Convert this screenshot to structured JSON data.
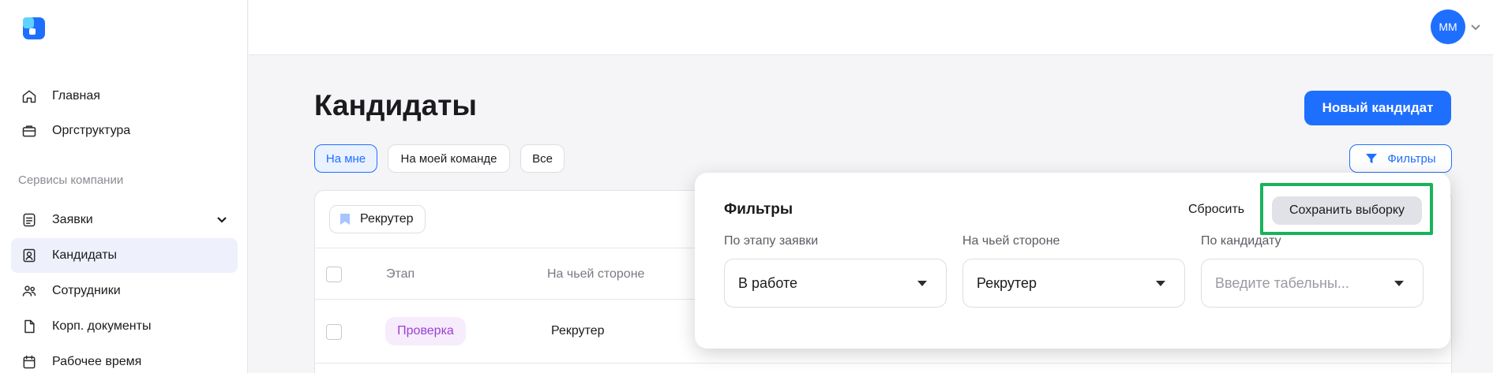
{
  "sidebar": {
    "items": [
      {
        "label": "Главная",
        "icon": "home-icon"
      },
      {
        "label": "Оргструктура",
        "icon": "briefcase-icon"
      },
      {
        "label": "Заявки",
        "icon": "document-list-icon"
      },
      {
        "label": "Кандидаты",
        "icon": "candidate-card-icon"
      },
      {
        "label": "Сотрудники",
        "icon": "people-icon"
      },
      {
        "label": "Корп. документы",
        "icon": "file-icon"
      },
      {
        "label": "Рабочее время",
        "icon": "calendar-icon"
      }
    ],
    "section_title": "Сервисы компании"
  },
  "header": {
    "avatar_initials": "ММ"
  },
  "main": {
    "title": "Кандидаты",
    "new_candidate_label": "Новый кандидат",
    "chips": [
      "На мне",
      "На моей команде",
      "Все"
    ],
    "filters_label": "Фильтры",
    "tag_chip_label": "Рекрутер",
    "table": {
      "columns": [
        "Этап",
        "На чьей стороне"
      ],
      "rows": [
        {
          "stage": "Проверка",
          "side": "Рекрутер"
        }
      ]
    }
  },
  "popup": {
    "title": "Фильтры",
    "reset_label": "Сбросить",
    "save_label": "Сохранить выборку",
    "fields": [
      {
        "label": "По этапу заявки",
        "value": "В работе",
        "placeholder": ""
      },
      {
        "label": "На чьей стороне",
        "value": "Рекрутер",
        "placeholder": ""
      },
      {
        "label": "По кандидату",
        "value": "",
        "placeholder": "Введите табельны..."
      }
    ]
  },
  "colors": {
    "accent": "#1f6fff",
    "highlight": "#17b35b",
    "stage_badge": "#9b3fd6"
  }
}
